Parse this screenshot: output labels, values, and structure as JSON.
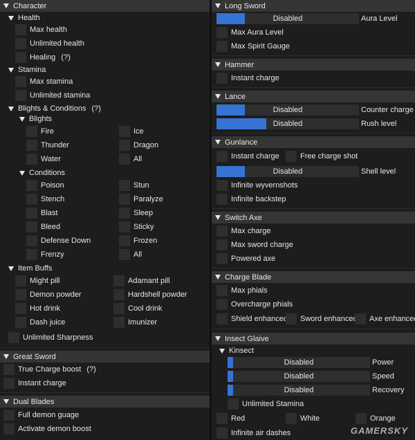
{
  "left": {
    "character": {
      "title": "Character",
      "health": {
        "title": "Health",
        "max_health": "Max health",
        "unlimited_health": "Unlimited health",
        "healing": "Healing",
        "healing_help": "(?)"
      },
      "stamina": {
        "title": "Stamina",
        "max_stamina": "Max stamina",
        "unlimited_stamina": "Unlimited stamina"
      },
      "blights_conditions": {
        "title": "Blights & Conditions",
        "help": "(?)",
        "blights": {
          "title": "Blights",
          "items": [
            "Fire",
            "Ice",
            "Thunder",
            "Dragon",
            "Water",
            "All"
          ]
        },
        "conditions": {
          "title": "Conditions",
          "items": [
            "Poison",
            "Stun",
            "Stench",
            "Paralyze",
            "Blast",
            "Sleep",
            "Bleed",
            "Sticky",
            "Defense Down",
            "Frozen",
            "Frenzy",
            "All"
          ]
        }
      },
      "item_buffs": {
        "title": "Item Buffs",
        "items": [
          "Might pill",
          "Adamant pill",
          "Demon powder",
          "Hardshell powder",
          "Hot drink",
          "Cool drink",
          "Dash juice",
          "Imunizer"
        ]
      },
      "unlimited_sharpness": "Unlimited Sharpness"
    },
    "great_sword": {
      "title": "Great Sword",
      "true_charge": "True Charge boost",
      "true_charge_help": "(?)",
      "instant_charge": "Instant charge"
    },
    "dual_blades": {
      "title": "Dual Blades",
      "full_demon": "Full demon guage",
      "activate_demon": "Activate demon boost"
    }
  },
  "right": {
    "long_sword": {
      "title": "Long Sword",
      "slider_text": "Disabled",
      "slider_label": "Aura Level",
      "slider_level": 0.2,
      "max_aura": "Max Aura Level",
      "max_spirit": "Max Spirit Gauge"
    },
    "hammer": {
      "title": "Hammer",
      "instant_charge": "Instant charge"
    },
    "lance": {
      "title": "Lance",
      "counter_text": "Disabled",
      "counter_label": "Counter charge l",
      "counter_level": 0.2,
      "rush_text": "Disabled",
      "rush_label": "Rush level",
      "rush_level": 0.35
    },
    "gunlance": {
      "title": "Gunlance",
      "instant_charge": "Instant charge",
      "free_charge": "Free charge shot",
      "shell_text": "Disabled",
      "shell_label": "Shell level",
      "shell_level": 0.2,
      "infinite_wyvern": "Infinite wyvernshots",
      "infinite_backstep": "Infinite backstep"
    },
    "switch_axe": {
      "title": "Switch Axe",
      "max_charge": "Max charge",
      "max_sword": "Max sword charge",
      "powered_axe": "Powered axe"
    },
    "charge_blade": {
      "title": "Charge Blade",
      "max_phials": "Max phials",
      "overcharge": "Overcharge phials",
      "shield": "Shield enhanced",
      "sword": "Sword enhanced",
      "axe": "Axe enhanced"
    },
    "insect_glaive": {
      "title": "Insect Glaive",
      "kinsect": {
        "title": "Kinsect",
        "power_text": "Disabled",
        "power_label": "Power",
        "power_level": 0.04,
        "speed_text": "Disabled",
        "speed_label": "Speed",
        "speed_level": 0.04,
        "recovery_text": "Disabled",
        "recovery_label": "Recovery",
        "recovery_level": 0.04,
        "unlimited_stamina": "Unlimited Stamina"
      },
      "red": "Red",
      "white": "White",
      "orange": "Orange",
      "infinite_air": "Infinite air dashes"
    }
  },
  "watermark": "GAMERSKY",
  "colors": {
    "background": "#1d1d1d",
    "header": "#353535",
    "checkbox": "#2e2e2e",
    "slider_fill": "#3574d4",
    "text": "#e6e6e6"
  }
}
